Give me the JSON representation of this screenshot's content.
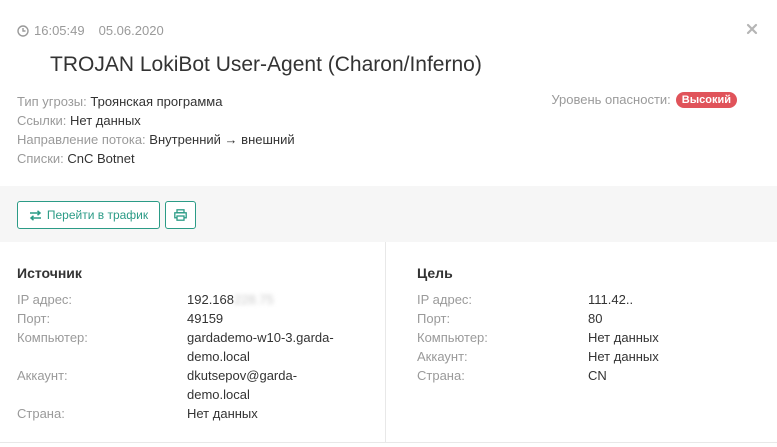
{
  "header": {
    "time": "16:05:49",
    "date": "05.06.2020",
    "title": "TROJAN LokiBot User-Agent (Charon/Inferno)"
  },
  "meta": {
    "threat_type_label": "Тип угрозы:",
    "threat_type_value": "Троянская программа",
    "links_label": "Ссылки:",
    "links_value": "Нет данных",
    "direction_label": "Направление потока:",
    "direction_value": "Внутренний → внешний",
    "lists_label": "Списки:",
    "lists_value": "CnC Botnet",
    "severity_label": "Уровень опасности:",
    "severity_value": "Высокий"
  },
  "toolbar": {
    "traffic_label": "Перейти в трафик"
  },
  "source": {
    "title": "Источник",
    "ip_label": "IP адрес:",
    "ip_value": "192.168",
    "ip_hidden": "228.75",
    "port_label": "Порт:",
    "port_value": "49159",
    "computer_label": "Компьютер:",
    "computer_value_1": "gardademo-w10-3.garda-",
    "computer_value_2": "demo.local",
    "account_label": "Аккаунт:",
    "account_value_1": "dkutsepov@garda-",
    "account_value_2": "demo.local",
    "country_label": "Страна:",
    "country_value": "Нет данных"
  },
  "target": {
    "title": "Цель",
    "ip_label": "IP адрес:",
    "ip_value": "111.42..",
    "port_label": "Порт:",
    "port_value": "80",
    "computer_label": "Компьютер:",
    "computer_value": "Нет данных",
    "account_label": "Аккаунт:",
    "account_value": "Нет данных",
    "country_label": "Страна:",
    "country_value": "CN"
  },
  "colors": {
    "accent": "#2b9b86",
    "severity_high": "#e0535a",
    "muted_text": "#9a9a9a"
  }
}
